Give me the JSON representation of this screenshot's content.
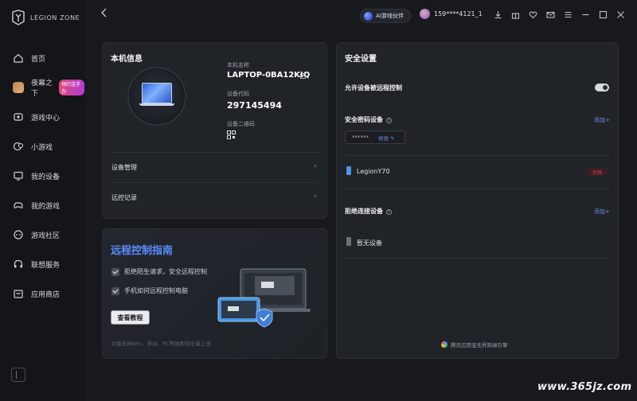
{
  "app": {
    "brand": "LEGION ZONE"
  },
  "sidebar": {
    "items": [
      {
        "label": "首页",
        "icon": "home-icon"
      },
      {
        "label": "夜幕之下",
        "icon": "game-thumb",
        "badge": "预约送手办"
      },
      {
        "label": "游戏中心",
        "icon": "gamepad-icon"
      },
      {
        "label": "小游戏",
        "icon": "chat-game-icon"
      },
      {
        "label": "我的设备",
        "icon": "monitor-icon"
      },
      {
        "label": "我的游戏",
        "icon": "controller-icon"
      },
      {
        "label": "游戏社区",
        "icon": "community-icon"
      },
      {
        "label": "联想服务",
        "icon": "headset-icon"
      },
      {
        "label": "应用商店",
        "icon": "store-icon"
      }
    ]
  },
  "topbar": {
    "ai_label": "AI游戏伙伴",
    "user": "159****4121_1"
  },
  "device_info": {
    "title": "本机信息",
    "name_label": "本机名称",
    "name": "LAPTOP-0BA12KIQ",
    "code_label": "设备代码",
    "code": "297145494",
    "qr_label": "设备二维码",
    "manage": "设备管理",
    "records": "远控记录"
  },
  "guide": {
    "title": "远程控制指南",
    "item1": "拒绝陌生请求，安全远程控制",
    "item2": "手机如何远程控制电脑",
    "button": "查看教程",
    "footnote": "功能支持Win、移动、PC等端即将全量上线"
  },
  "security": {
    "title": "安全设置",
    "allow_label": "允许设备被远程控制",
    "pwd_device_label": "安全密码设备",
    "add_label": "添加+",
    "pwd_mask": "******",
    "pwd_edit": "修改",
    "device_name": "LegionY70",
    "device_status": "在线",
    "reject_label": "拒绝连接设备",
    "add_label_2": "添加+",
    "no_device": "暂无设备",
    "footer": "腾讯应用宝无界跨端引擎"
  },
  "watermark": "www.365jz.com",
  "colors": {
    "accent": "#5b8cff",
    "link": "#6d8fe8",
    "danger": "#e0445a"
  }
}
